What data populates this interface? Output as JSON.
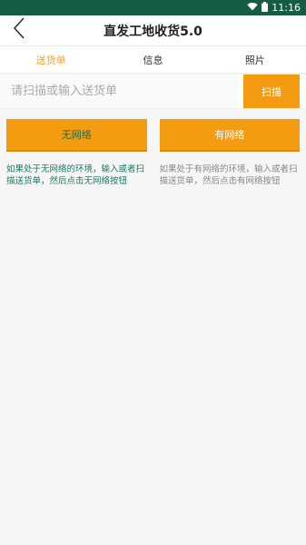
{
  "status_bar": {
    "time": "11:16",
    "icons": [
      "wifi-icon",
      "battery-icon"
    ]
  },
  "app_bar": {
    "title": "直发工地收货5.0",
    "back_icon": "chevron-left-icon"
  },
  "tabs": [
    {
      "label": "送货单",
      "active": true
    },
    {
      "label": "信息",
      "active": false
    },
    {
      "label": "照片",
      "active": false
    }
  ],
  "search": {
    "placeholder": "请扫描或输入送货单",
    "value": "",
    "scan_label": "扫描"
  },
  "modes": {
    "offline": {
      "label": "无网络",
      "description": "如果处于无网络的环境，输入或者扫描送货单，然后点击无网络按钮"
    },
    "online": {
      "label": "有网络",
      "description": "如果处于有网络的环境，输入或者扫描送货单，然后点击有网络按钮"
    }
  },
  "colors": {
    "status_bar": "#145c43",
    "accent": "#f39c12",
    "active_tab": "#ff9f1c",
    "offline_text": "#1a7a5e"
  }
}
